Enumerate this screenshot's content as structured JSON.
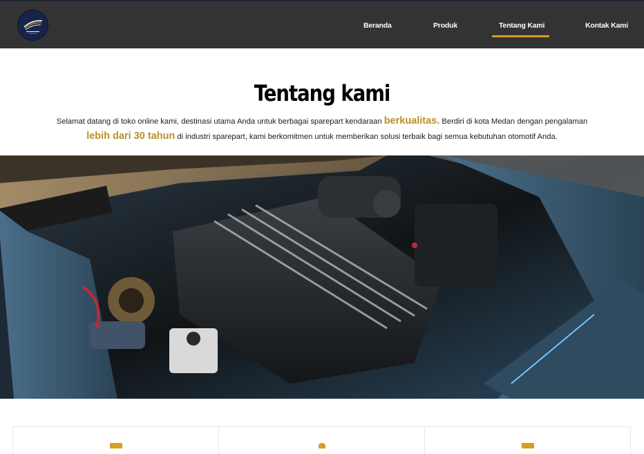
{
  "nav": {
    "items": [
      {
        "label": "Beranda"
      },
      {
        "label": "Produk"
      },
      {
        "label": "Tentang Kami"
      },
      {
        "label": "Kontak Kami"
      }
    ],
    "active_index": 2
  },
  "about": {
    "title": "Tentang kami",
    "text_part1": "Selamat datang di toko online kami, destinasi utama Anda untuk berbagai sparepart kendaraan ",
    "highlight1": "berkualitas.",
    "text_part2": " Berdiri di kota Medan dengan pengalaman ",
    "highlight2": "lebih dari 30 tahun",
    "text_part3": " di industri sparepart, kami berkomitmen untuk memberikan solusi terbaik bagi semua kebutuhan otomotif Anda."
  },
  "hero": {
    "icon": "car-engine-photo"
  },
  "cards": [
    {
      "icon": "feature-icon-1"
    },
    {
      "icon": "feature-icon-2"
    },
    {
      "icon": "feature-icon-3"
    }
  ],
  "colors": {
    "navbar_bg": "#333333",
    "accent": "#d5a021",
    "highlight_text": "#b9902a",
    "logo_bg": "#17234a"
  }
}
